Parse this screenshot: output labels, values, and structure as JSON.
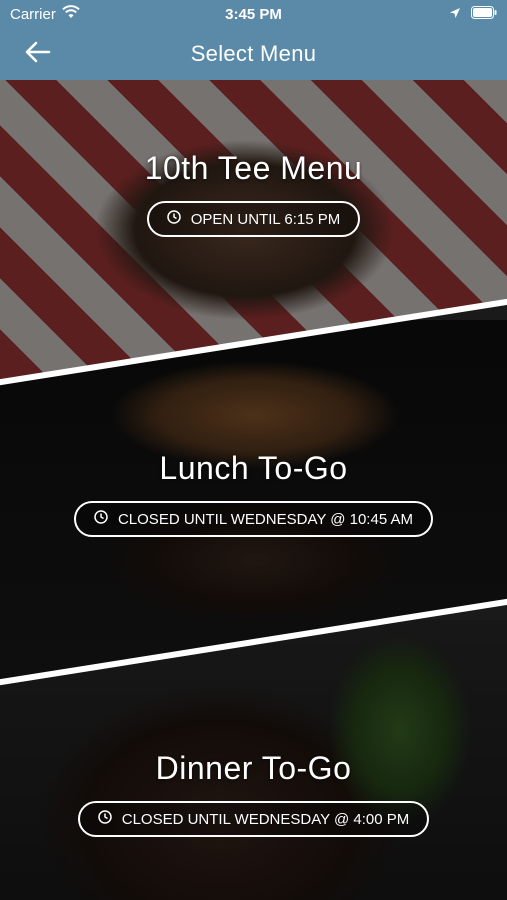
{
  "status_bar": {
    "carrier": "Carrier",
    "time": "3:45 PM"
  },
  "nav": {
    "title": "Select Menu"
  },
  "menus": [
    {
      "title": "10th Tee Menu",
      "status": "OPEN UNTIL 6:15 PM"
    },
    {
      "title": "Lunch To-Go",
      "status": "CLOSED UNTIL WEDNESDAY @ 10:45 AM"
    },
    {
      "title": "Dinner To-Go",
      "status": "CLOSED UNTIL WEDNESDAY @ 4:00 PM"
    }
  ],
  "colors": {
    "header": "#5b8aa8",
    "text": "#ffffff"
  }
}
